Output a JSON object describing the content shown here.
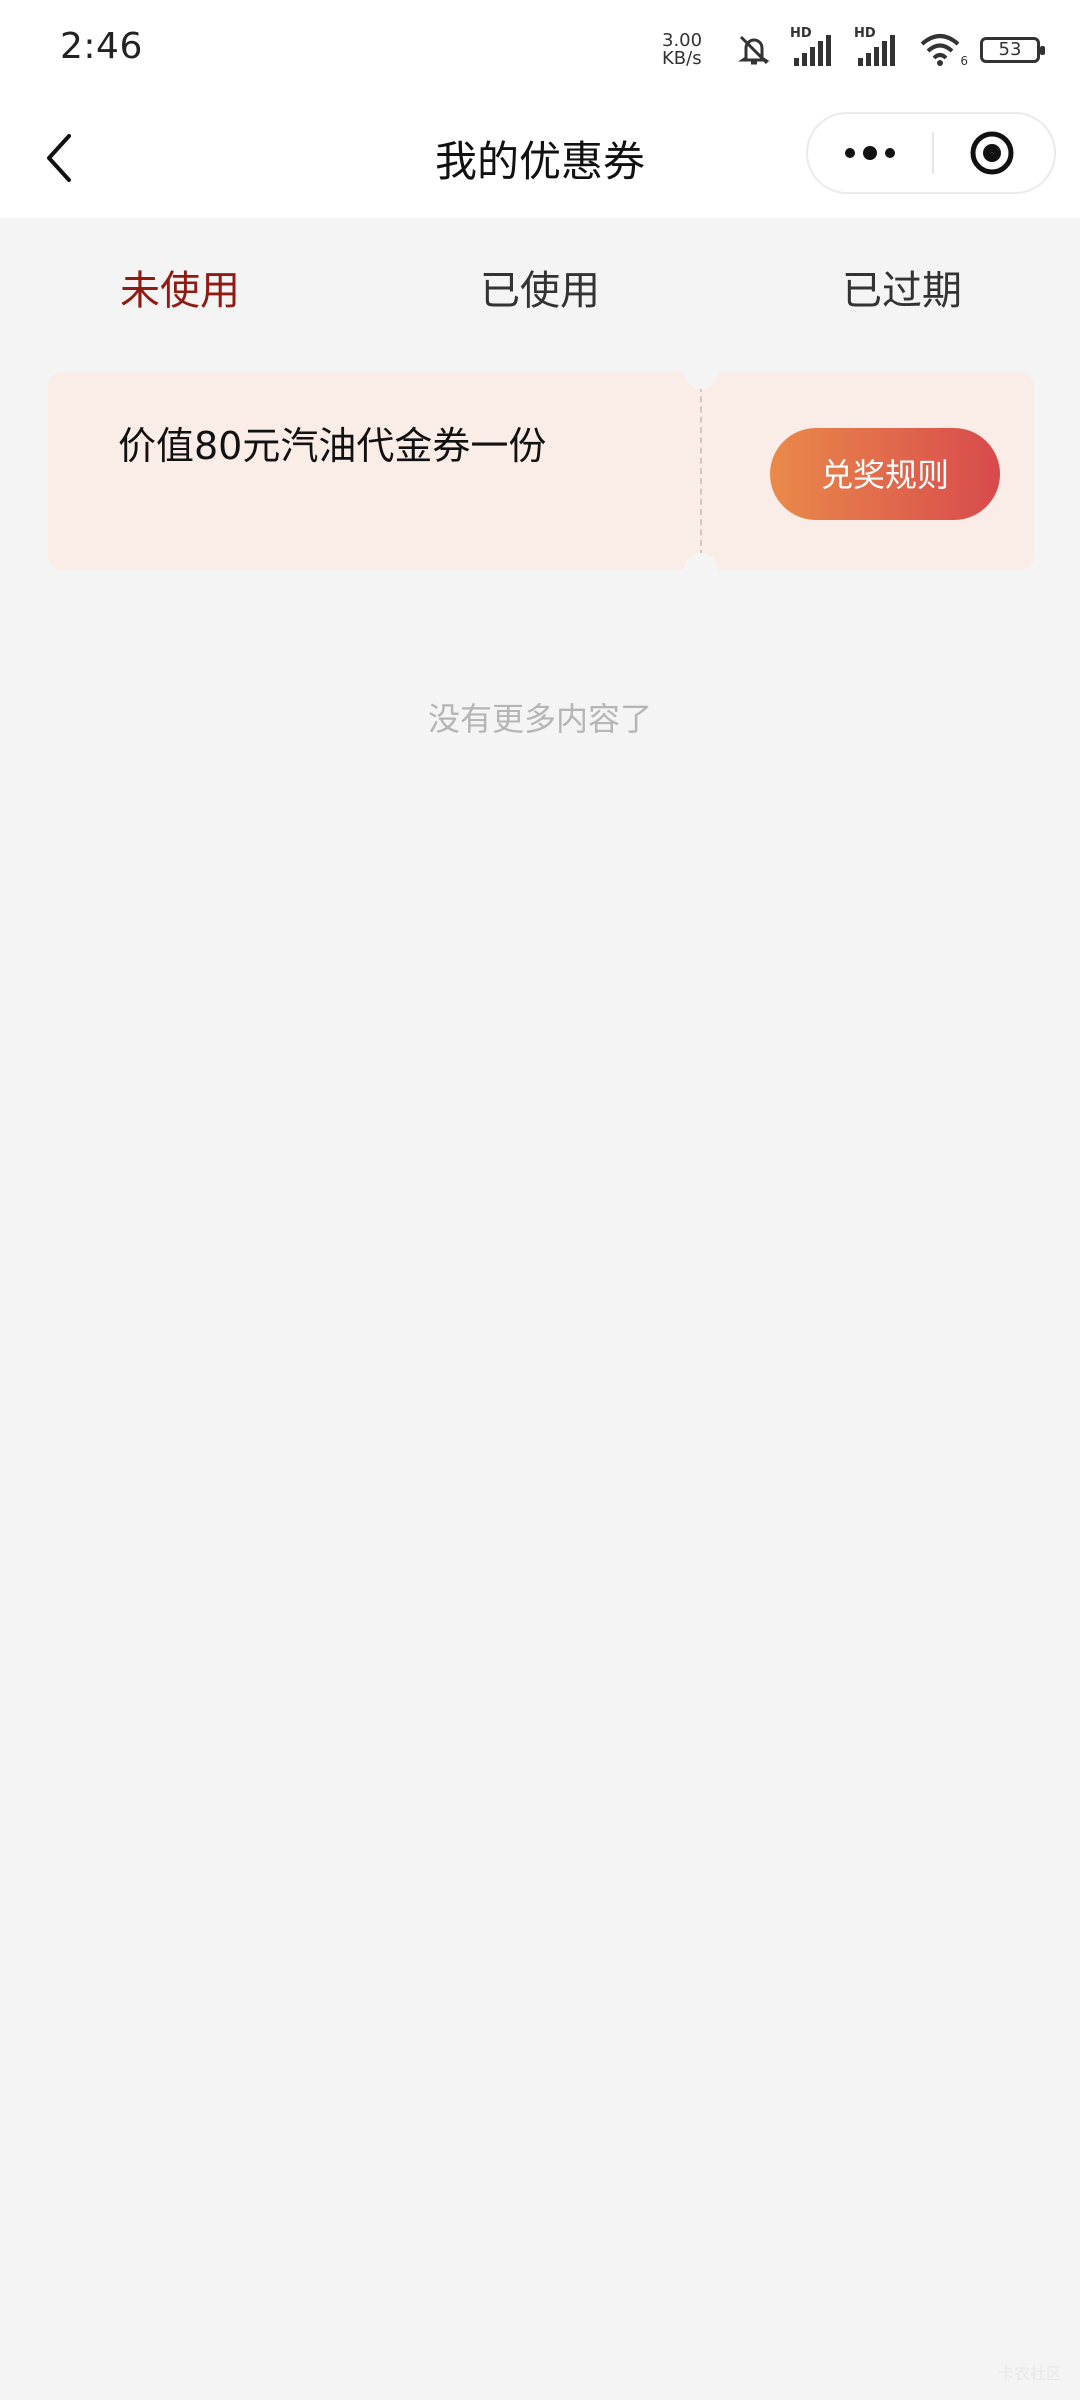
{
  "status_bar": {
    "time": "2:46",
    "net_speed_value": "3.00",
    "net_speed_unit": "KB/s",
    "signal_label_1": "HD",
    "signal_label_2": "HD",
    "wifi_badge": "6",
    "battery": "53",
    "icons": [
      "bell-muted-icon",
      "signal-icon",
      "signal-icon",
      "wifi-icon",
      "battery-icon"
    ]
  },
  "nav": {
    "title": "我的优惠券",
    "back_icon": "chevron-left-icon",
    "more_icon": "more-dots-icon",
    "close_icon": "target-circle-icon"
  },
  "tabs": [
    {
      "label": "未使用",
      "active": true
    },
    {
      "label": "已使用",
      "active": false
    },
    {
      "label": "已过期",
      "active": false
    }
  ],
  "coupon": {
    "title": "价值80元汽油代金券一份",
    "button_label": "兑奖规则"
  },
  "empty_hint": "没有更多内容了",
  "watermark": "卡农社区",
  "colors": {
    "active_tab": "#8e1b14",
    "coupon_bg": "#faece6",
    "button_gradient_start": "#ea8a4a",
    "button_gradient_end": "#d84a4d",
    "page_bg": "#f4f4f4"
  }
}
